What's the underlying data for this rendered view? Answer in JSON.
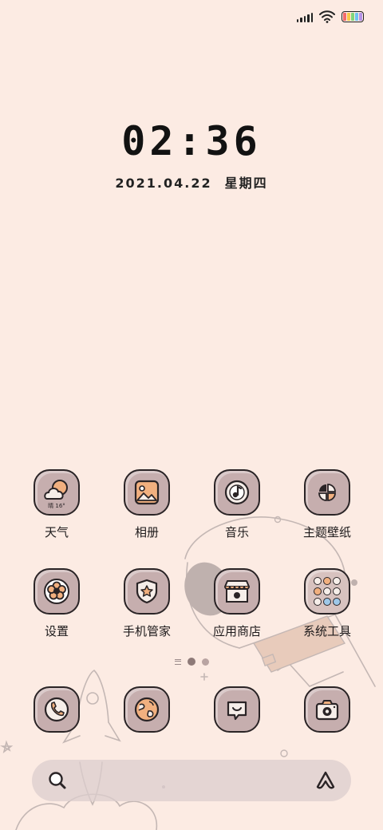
{
  "status_bar": {
    "signal_icon": "signal-bars-icon",
    "wifi_icon": "wifi-icon",
    "battery_icon": "battery-icon",
    "battery_colors": [
      "#f26b6b",
      "#f7c948",
      "#7fd67a",
      "#6ec3f0",
      "#b693e8"
    ]
  },
  "lockclock": {
    "time": "02:36",
    "date": "2021.04.22",
    "weekday": "星期四"
  },
  "weather_widget": {
    "icon_text": "晴 16°"
  },
  "apps": [
    {
      "label": "天气",
      "icon": "weather-icon"
    },
    {
      "label": "相册",
      "icon": "gallery-icon"
    },
    {
      "label": "音乐",
      "icon": "music-icon"
    },
    {
      "label": "主题壁纸",
      "icon": "themes-icon"
    },
    {
      "label": "设置",
      "icon": "settings-icon"
    },
    {
      "label": "手机管家",
      "icon": "security-icon"
    },
    {
      "label": "应用商店",
      "icon": "app-store-icon"
    },
    {
      "label": "系统工具",
      "icon": "folder-icon"
    }
  ],
  "dock": [
    {
      "icon": "phone-icon"
    },
    {
      "icon": "browser-icon"
    },
    {
      "icon": "messages-icon"
    },
    {
      "icon": "camera-icon"
    }
  ],
  "page_indicator": {
    "total_pages": 2,
    "active_page": 1
  },
  "search_bar": {
    "search_icon": "search-icon",
    "assistant_icon": "assistant-icon"
  },
  "colors": {
    "background": "#fcebe3",
    "icon_fill": "#c6aeae",
    "icon_outline": "#2a2426",
    "accent": "#f1b07f"
  }
}
